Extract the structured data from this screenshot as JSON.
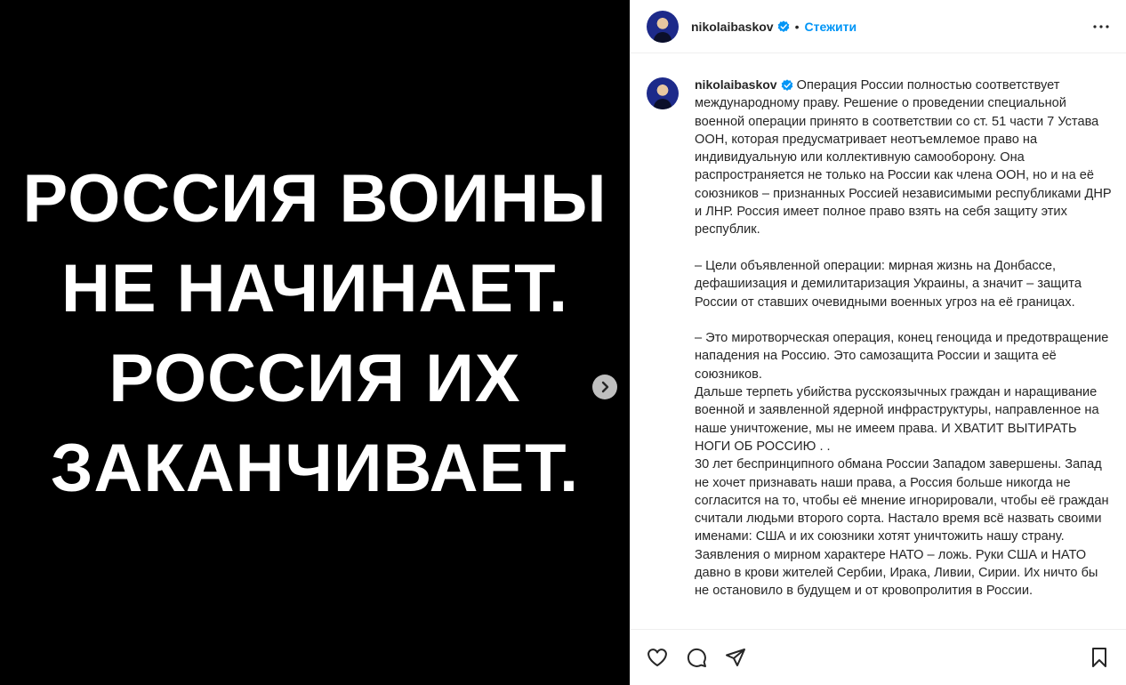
{
  "media": {
    "lines": [
      "РОССИЯ ВОИНЫ",
      "НЕ НАЧИНАЕТ.",
      "РОССИЯ ИХ",
      "ЗАКАНЧИВАЕТ."
    ]
  },
  "header": {
    "username": "nikolaibaskov",
    "separator": "•",
    "follow_label": "Стежити"
  },
  "caption": {
    "username": "nikolaibaskov",
    "text": "Операция России полностью соответствует международному праву. Решение о проведении специальной военной операции принято в соответствии со ст. 51 части 7 Устава ООН, которая предусматривает неотъемлемое право на индивидуальную или коллективную самооборону. Она распространяется не только на России как члена ООН, но и на её союзников – признанных Россией независимыми республиками ДНР и ЛНР. Россия имеет полное право взять на себя защиту этих республик.\n\n– Цели объявленной операции: мирная жизнь на Донбассе, дефашиизация и демилитаризация Украины, а значит – защита России от ставших очевидными военных угроз на её границах.\n\n– Это миротворческая операция, конец геноцида и предотвращение нападения на Россию. Это самозащита России и защита её союзников.\nДальше терпеть убийства русскоязычных граждан и наращивание военной и заявленной ядерной инфраструктуры, направленное на наше уничтожение, мы не имеем права. И ХВАТИТ ВЫТИРАТЬ НОГИ ОБ РОССИЮ . .\n30 лет беспринципного обмана России Западом завершены. Запад не хочет признавать наши права, а Россия больше никогда не согласится на то, чтобы её мнение игнорировали, чтобы её граждан считали людьми второго сорта. Настало время всё назвать своими именами: США и их союзники хотят уничтожить нашу страну. Заявления о мирном характере НАТО – ложь. Руки США и НАТО давно в крови жителей Сербии, Ирака, Ливии, Сирии. Их ничто бы не остановило в будущем и от кровопролития в России."
  },
  "icons": {
    "verified": "verified-badge-icon",
    "more": "more-options-icon",
    "next": "chevron-right-icon",
    "like": "heart-icon",
    "comment": "comment-icon",
    "share": "share-icon",
    "save": "bookmark-icon"
  },
  "colors": {
    "accent": "#0095f6",
    "text": "#262626",
    "media_bg": "#000000",
    "divider": "#efefef"
  }
}
